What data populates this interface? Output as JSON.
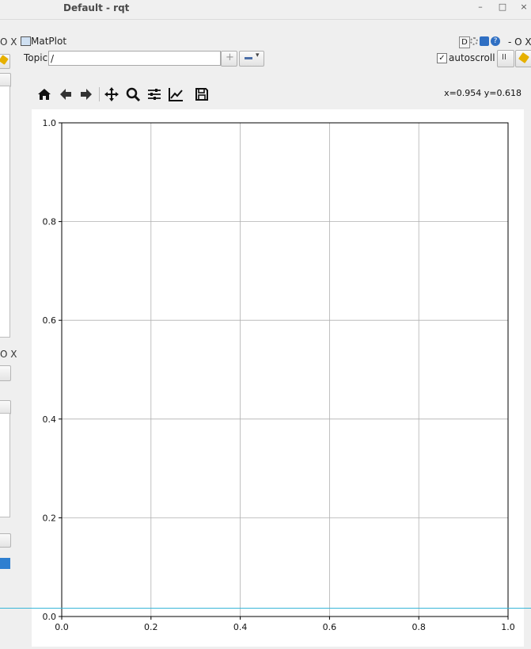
{
  "window": {
    "title": "Default - rqt",
    "min": "–",
    "max": "□",
    "close": "×"
  },
  "left_panel": {
    "dock_label_top": "O X",
    "dock_label_mid": "O X"
  },
  "plugin": {
    "title": "MatPlot",
    "header_right": "- O X",
    "topic_label": "Topic",
    "topic_value": "/",
    "add_label": "+",
    "remove_label": "−",
    "autoscroll_label": "autoscroll",
    "autoscroll_checked": true,
    "pause_label": "II"
  },
  "toolbar": {
    "icons": [
      "home-icon",
      "back-arrow-icon",
      "forward-arrow-icon",
      "pan-icon",
      "zoom-icon",
      "configure-subplots-icon",
      "edit-axis-icon",
      "save-icon"
    ],
    "coord_readout": "x=0.954 y=0.618"
  },
  "chart_data": {
    "type": "line",
    "title": "",
    "xlabel": "",
    "ylabel": "",
    "xlim": [
      0.0,
      1.0
    ],
    "ylim": [
      0.0,
      1.0
    ],
    "xticks": [
      "0.0",
      "0.2",
      "0.4",
      "0.6",
      "0.8",
      "1.0"
    ],
    "yticks": [
      "0.0",
      "0.2",
      "0.4",
      "0.6",
      "0.8",
      "1.0"
    ],
    "grid": true,
    "series": []
  }
}
